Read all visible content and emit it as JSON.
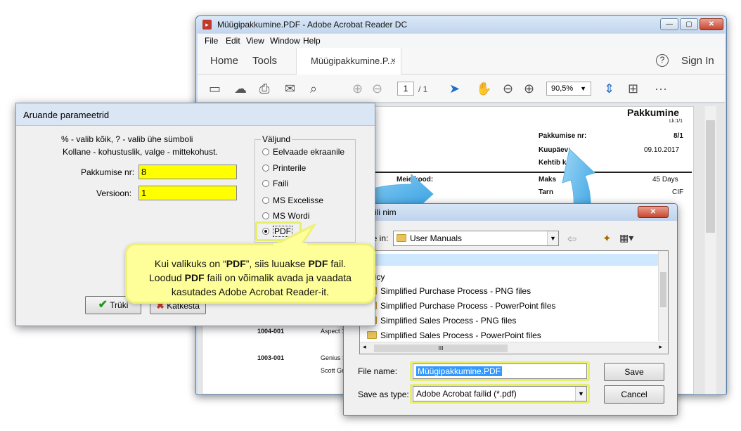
{
  "acrobat": {
    "title": "Müügipakkumine.PDF - Adobe Acrobat Reader DC",
    "menu": [
      "File",
      "Edit",
      "View",
      "Window",
      "Help"
    ],
    "tabs": {
      "home": "Home",
      "tools": "Tools",
      "doc": "Müügipakkumine.P...",
      "close": "×",
      "help": "?",
      "signin": "Sign In"
    },
    "page_current": "1",
    "page_total": "/ 1",
    "zoom": "90,5%",
    "document": {
      "heading": "Pakkumine",
      "page_label": "Lk:1/1",
      "offer_no_label": "Pakkumise nr:",
      "offer_no": "8/1",
      "date_label": "Kuupäev:",
      "date": "09.10.2017",
      "validity_label": "Kehtib kuni:",
      "our_code_label": "Meie kood:",
      "payment_label": "Maks",
      "payment": "45 Days",
      "delivery_label": "Tarn",
      "delivery": "CIF",
      "row1_code": "1004-001",
      "row1_name": "Aspect 1",
      "row2_code": "1003-001",
      "row2_name": "Genius S",
      "row3_name": "Scott Ge"
    }
  },
  "report_dialog": {
    "title": "Aruande parameetrid",
    "hint1": "% - valib kõik, ? - valib ühe sümboli",
    "hint2": "Kollane - kohustuslik, valge - mittekohust.",
    "offer_label": "Pakkumise nr:",
    "offer_value": "8",
    "version_label": "Versioon:",
    "version_value": "1",
    "output_group": "Väljund",
    "outputs": [
      "Eelvaade ekraanile",
      "Printerile",
      "Faili",
      "MS Excelisse",
      "MS Wordi",
      "PDF"
    ],
    "selected_output": "PDF",
    "print_button": "Trüki",
    "cancel_button": "Katkesta"
  },
  "save_dialog": {
    "title": "Faili nim",
    "save_in_label": "Save in:",
    "save_in_value": "User Manuals",
    "files": [
      "licy",
      "Simplified Purchase Process - PNG files",
      "Simplified Purchase Process - PowerPoint files",
      "Simplified Sales Process - PNG files",
      "Simplified Sales Process - PowerPoint files"
    ],
    "scroll_thumb": "III",
    "filename_label": "File name:",
    "filename_value": "Müügipakkumine.PDF",
    "type_label": "Save as type:",
    "type_value": "Adobe Acrobat failid (*.pdf)",
    "save_button": "Save",
    "cancel_button": "Cancel"
  },
  "callout": {
    "l1a": "Kui valikuks on “",
    "l1b": "PDF",
    "l1c": "”, siis luuakse ",
    "l1d": "PDF",
    "l1e": " fail.",
    "l2a": "Loodud ",
    "l2b": "PDF",
    "l2c": " faili on võimalik avada ja vaadata",
    "l3": "kasutades Adobe Acrobat Reader-it."
  },
  "colors": {
    "mandatory_field": "#ffff00",
    "callout_bg": "#ffff99",
    "highlight": "#e6ee6a",
    "arrow": "#2fa8e8"
  }
}
